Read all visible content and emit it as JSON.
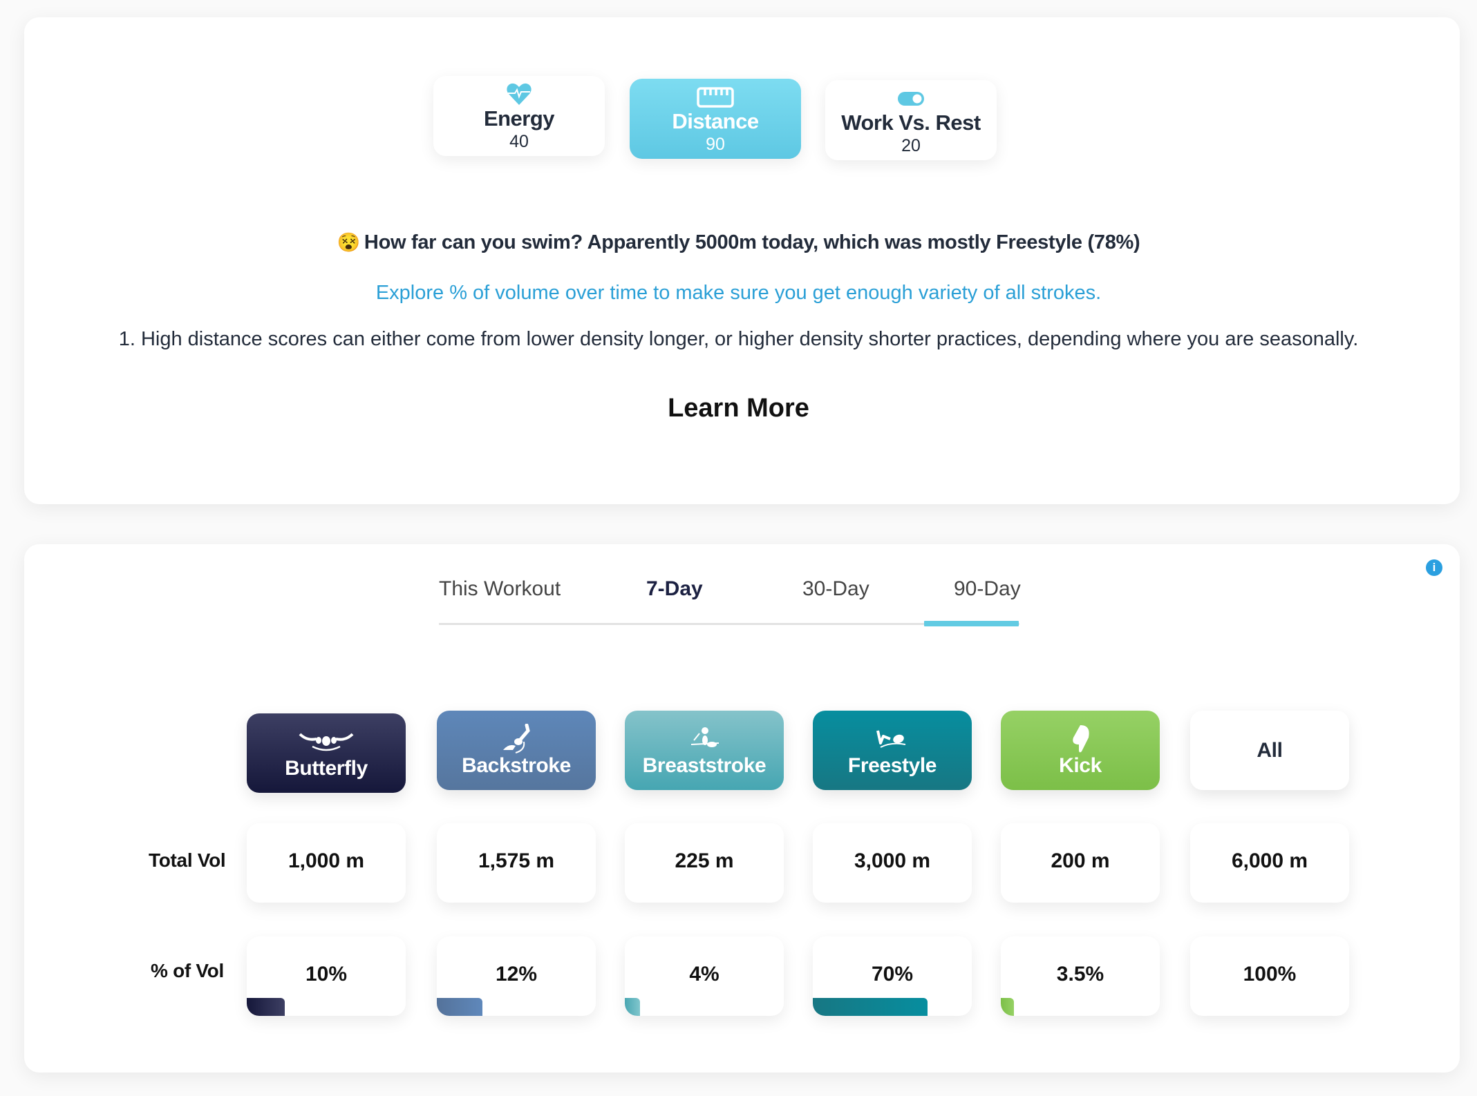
{
  "scores": [
    {
      "id": "energy",
      "label": "Energy",
      "value": "40",
      "icon": "heart-pulse-icon",
      "active": false
    },
    {
      "id": "distance",
      "label": "Distance",
      "value": "90",
      "icon": "ruler-icon",
      "active": true
    },
    {
      "id": "wvr",
      "label": "Work Vs. Rest",
      "value": "20",
      "icon": "toggle-icon",
      "active": false
    }
  ],
  "insight": {
    "emoji": "😵",
    "headline": "How far can you swim? Apparently 5000m today, which was mostly Freestyle (78%)",
    "explore_link": "Explore % of volume over time to make sure you get enough variety of all strokes.",
    "tip": "1. High distance scores can either come from lower density longer, or higher density shorter practices, depending where you are seasonally.",
    "learn_more": "Learn More"
  },
  "tabs": [
    {
      "label": "This Workout",
      "bold": false
    },
    {
      "label": "7-Day",
      "bold": true
    },
    {
      "label": "30-Day",
      "bold": false
    },
    {
      "label": "90-Day",
      "bold": false,
      "indicator": true
    }
  ],
  "info_icon": "i",
  "row_labels": {
    "total": "Total Vol",
    "percent": "% of Vol"
  },
  "strokes": [
    {
      "name": "Butterfly",
      "icon": "butterfly-swimmer-icon",
      "total": "1,000 m",
      "percent_label": "10%",
      "percent": 10,
      "colors": [
        "#3d3f63",
        "#15173a"
      ],
      "bar": [
        "#15173a",
        "#3d3f63"
      ]
    },
    {
      "name": "Backstroke",
      "icon": "backstroke-swimmer-icon",
      "total": "1,575 m",
      "percent_label": "12%",
      "percent": 12,
      "colors": [
        "#5e87b9",
        "#56769e"
      ],
      "bar": [
        "#54729a",
        "#5f88bb"
      ]
    },
    {
      "name": "Breaststroke",
      "icon": "breaststroke-swimmer-icon",
      "total": "225 m",
      "percent_label": "4%",
      "percent": 4,
      "colors": [
        "#85c3ca",
        "#46a6b2"
      ],
      "bar": [
        "#4aa7b2",
        "#80c6cd"
      ]
    },
    {
      "name": "Freestyle",
      "icon": "freestyle-swimmer-icon",
      "total": "3,000 m",
      "percent_label": "70%",
      "percent": 70,
      "colors": [
        "#078e9f",
        "#177783"
      ],
      "bar": [
        "#177783",
        "#078e9f"
      ]
    },
    {
      "name": "Kick",
      "icon": "kickboard-icon",
      "total": "200 m",
      "percent_label": "3.5%",
      "percent": 3.5,
      "colors": [
        "#96d165",
        "#7cbf48"
      ],
      "bar": [
        "#7cbf48",
        "#96d165"
      ]
    },
    {
      "name": "All",
      "icon": "",
      "total": "6,000 m",
      "percent_label": "100%",
      "percent": 100,
      "colors": null,
      "bar": null
    }
  ]
}
